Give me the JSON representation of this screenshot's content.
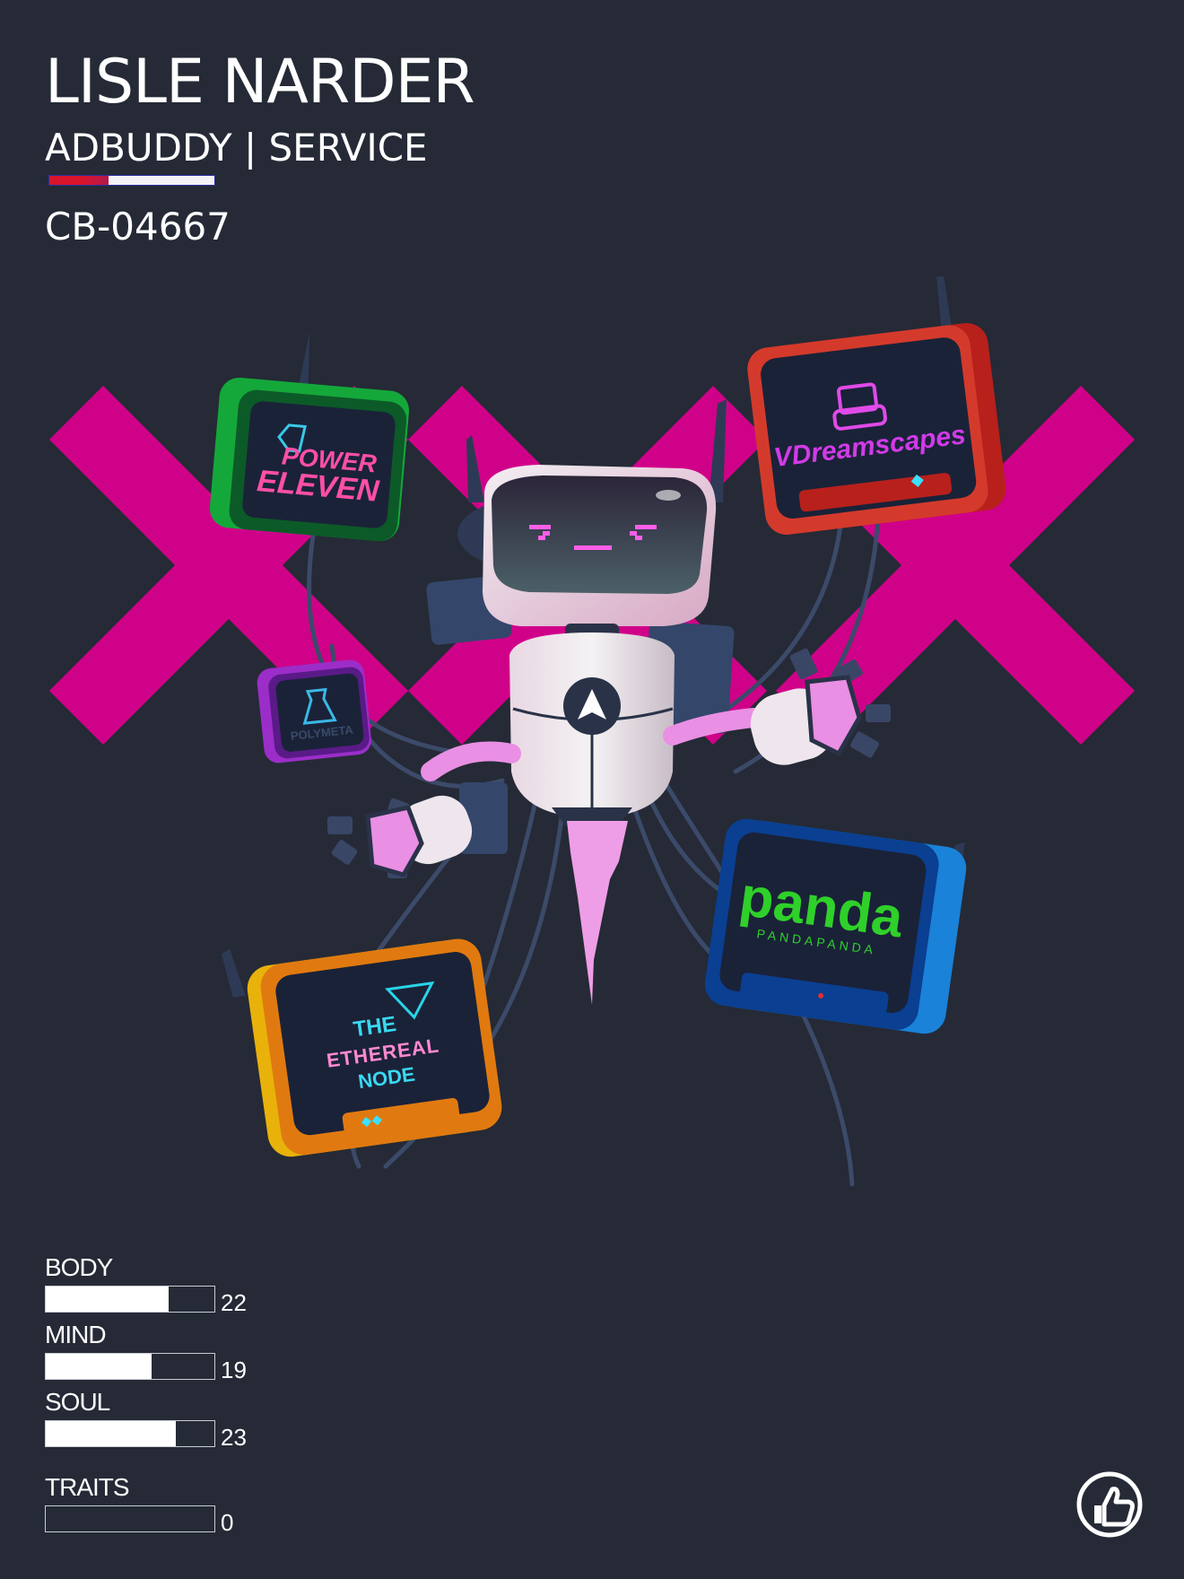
{
  "card": {
    "name": "LISLE NARDER",
    "role": "ADBUDDY | SERVICE",
    "id": "CB-04667"
  },
  "flag_colors": [
    "#d8142c",
    "#f4f2f6",
    "#2a2fa0"
  ],
  "artwork": {
    "background_mark": "magenta-x-pattern",
    "screens": [
      {
        "brand_lines": [
          "POWER",
          "ELEVEN"
        ],
        "frame_color": "#1fae3c"
      },
      {
        "brand_lines": [
          "VDreamscapes"
        ],
        "frame_color": "#c0302a"
      },
      {
        "brand_lines": [
          "POLYMETA"
        ],
        "frame_color": "#8c2cc4"
      },
      {
        "brand_lines": [
          "panda",
          "PANDAPANDA"
        ],
        "frame_color": "#0a4fb8"
      },
      {
        "brand_lines": [
          "THE",
          "ETHEREAL",
          "NODE"
        ],
        "frame_color": "#e07a10"
      }
    ]
  },
  "stats": [
    {
      "label": "BODY",
      "value": "22",
      "fill": 0.73
    },
    {
      "label": "MIND",
      "value": "19",
      "fill": 0.63
    },
    {
      "label": "SOUL",
      "value": "23",
      "fill": 0.77
    },
    {
      "label": "TRAITS",
      "value": "0",
      "fill": 0
    }
  ],
  "badge_icon": "thumbs-up-icon"
}
